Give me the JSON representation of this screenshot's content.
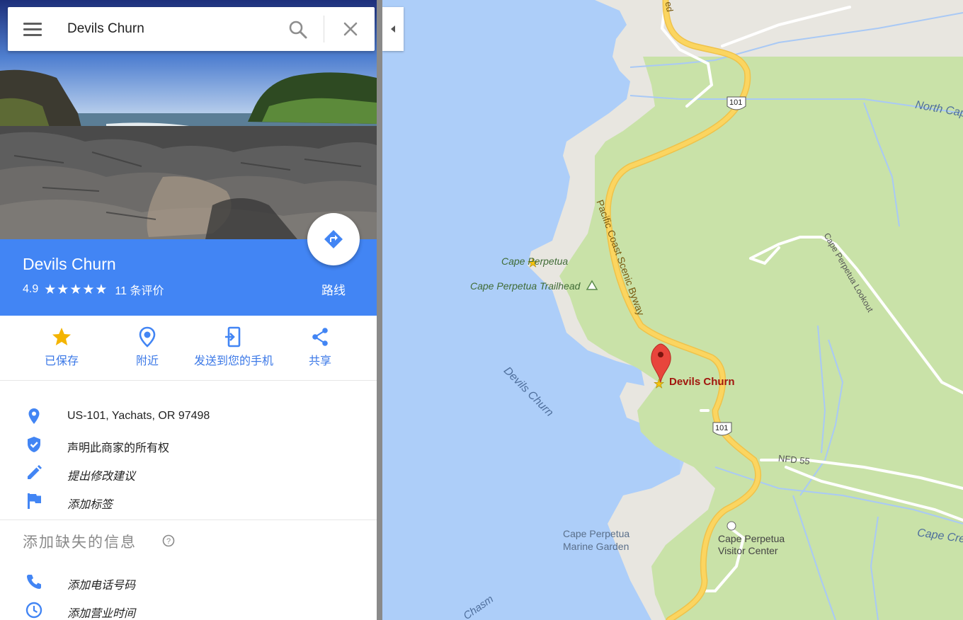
{
  "search": {
    "value": "Devils Churn"
  },
  "place": {
    "title": "Devils Churn",
    "rating": "4.9",
    "stars": "★★★★★",
    "reviews": "11 条评价",
    "directions_label": "路线"
  },
  "actions": [
    {
      "label": "已保存",
      "icon": "star-icon"
    },
    {
      "label": "附近",
      "icon": "nearby-icon"
    },
    {
      "label": "发送到您的手机",
      "icon": "send-to-phone-icon"
    },
    {
      "label": "共享",
      "icon": "share-icon"
    }
  ],
  "info": [
    {
      "text": "US-101, Yachats, OR 97498",
      "icon": "location-pin-icon"
    },
    {
      "text": "声明此商家的所有权",
      "icon": "verified-shield-icon"
    },
    {
      "text": "提出修改建议",
      "icon": "pencil-icon"
    },
    {
      "text": "添加标签",
      "icon": "flag-icon"
    }
  ],
  "missing": {
    "title": "添加缺失的信息",
    "items": [
      {
        "text": "添加电话号码",
        "icon": "phone-icon"
      },
      {
        "text": "添加营业时间",
        "icon": "clock-icon"
      }
    ]
  },
  "map": {
    "labels": {
      "north_cape": "North Cap",
      "cape_perpetua": "Cape Perpetua",
      "trailhead": "Cape Perpetua Trailhead",
      "scenic_byway": "Pacific Coast Scenic Byway",
      "lookout": "Cape Perpetua Lookout",
      "devils_churn_water": "Devils Churn",
      "devils_churn_marker": "Devils Churn",
      "nfd55": "NFD 55",
      "marine_garden_1": "Cape Perpetua",
      "marine_garden_2": "Marine Garden",
      "visitor_center_1": "Cape Perpetua",
      "visitor_center_2": "Visitor Center",
      "cape_creek": "Cape Cre",
      "chasm": "Chasm",
      "road_top": "ed",
      "shield_101_a": "101",
      "shield_101_b": "101"
    },
    "colors": {
      "water": "#abcdfb",
      "land": "#cde6ab",
      "shore": "#e9e7e1",
      "road": "#fad25c",
      "brand_blue": "#4285f4",
      "pin_red": "#e8453c"
    }
  }
}
